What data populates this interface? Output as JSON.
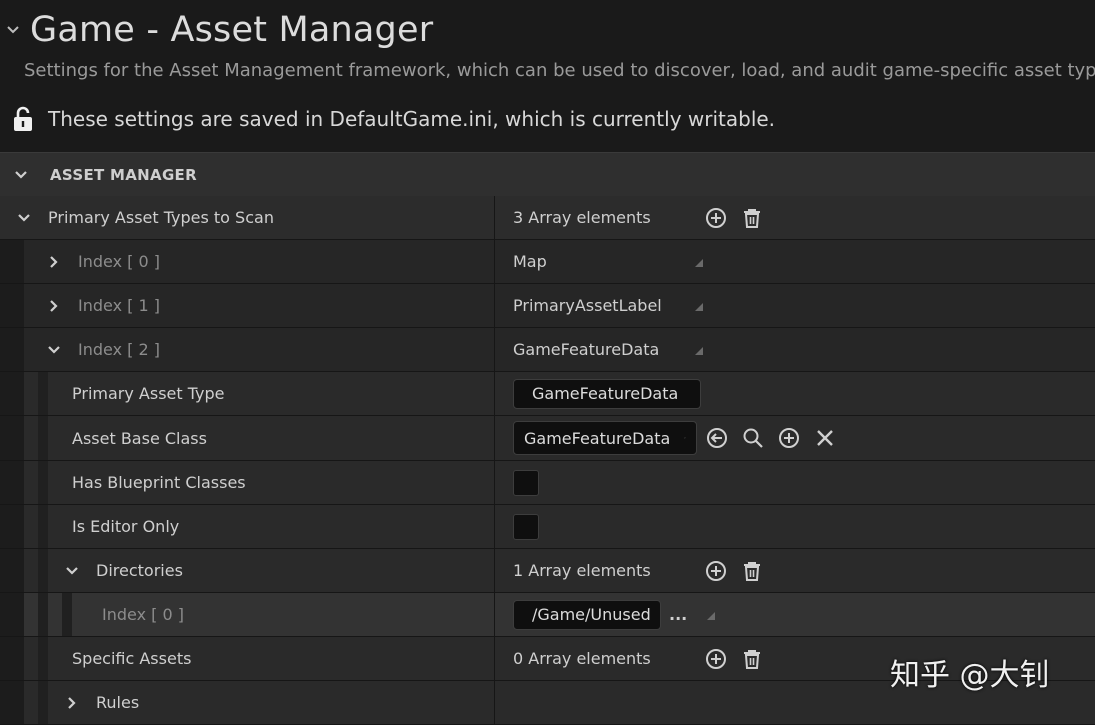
{
  "header": {
    "title": "Game - Asset Manager",
    "description": "Settings for the Asset Management framework, which can be used to discover, load, and audit game-specific asset types",
    "writable_note": "These settings are saved in DefaultGame.ini, which is currently writable."
  },
  "section": {
    "label": "ASSET MANAGER"
  },
  "rows": {
    "primary_types": {
      "label": "Primary Asset Types to Scan",
      "value": "3 Array elements"
    },
    "index0": {
      "label": "Index",
      "index": "[ 0 ]",
      "value": "Map"
    },
    "index1": {
      "label": "Index",
      "index": "[ 1 ]",
      "value": "PrimaryAssetLabel"
    },
    "index2": {
      "label": "Index",
      "index": "[ 2 ]",
      "value": "GameFeatureData"
    },
    "primary_asset_type": {
      "label": "Primary Asset Type",
      "value": "GameFeatureData"
    },
    "asset_base_class": {
      "label": "Asset Base Class",
      "value": "GameFeatureData"
    },
    "has_blueprint": {
      "label": "Has Blueprint Classes",
      "checked": false
    },
    "editor_only": {
      "label": "Is Editor Only",
      "checked": false
    },
    "directories": {
      "label": "Directories",
      "value": "1 Array elements"
    },
    "dir_index0": {
      "label": "Index",
      "index": "[ 0 ]",
      "value": "/Game/Unused",
      "more": "..."
    },
    "specific_assets": {
      "label": "Specific Assets",
      "value": "0 Array elements"
    },
    "rules": {
      "label": "Rules"
    }
  },
  "watermark": "知乎 @大钊",
  "colors": {
    "background": "#1a1a1a",
    "row": "#2c2c2c",
    "field": "#0f0f0f",
    "text": "#c8c8c8"
  }
}
